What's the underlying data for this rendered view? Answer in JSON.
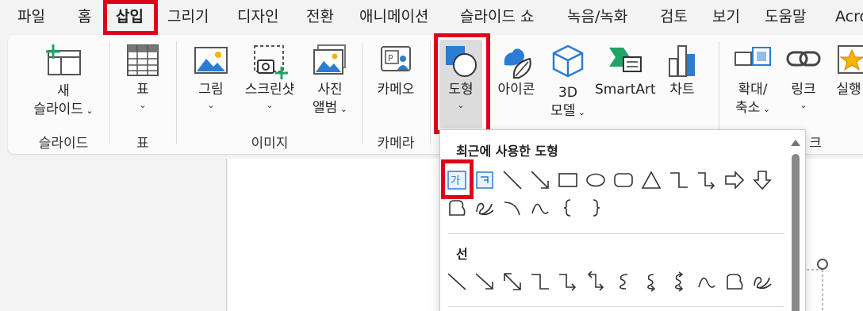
{
  "menu": {
    "tabs": [
      "파일",
      "홈",
      "삽입",
      "그리기",
      "디자인",
      "전환",
      "애니메이션",
      "슬라이드 쇼",
      "녹음/녹화",
      "검토",
      "보기",
      "도움말",
      "Acro"
    ],
    "active_index": 2
  },
  "ribbon": {
    "new_slide": {
      "line1": "새",
      "line2": "슬라이드"
    },
    "table": {
      "label": "표"
    },
    "pictures": {
      "label": "그림"
    },
    "screenshot": {
      "label": "스크린샷"
    },
    "photo_album": {
      "line1": "사진",
      "line2": "앨범"
    },
    "cameo": {
      "label": "카메오"
    },
    "shapes": {
      "label": "도형"
    },
    "icons": {
      "label": "아이콘"
    },
    "models3d": {
      "line1": "3D",
      "line2": "모델"
    },
    "smartart": {
      "label": "SmartArt"
    },
    "chart": {
      "label": "차트"
    },
    "zoom": {
      "line1": "확대/",
      "line2": "축소"
    },
    "link": {
      "label": "링크"
    },
    "action": {
      "label": "실행"
    },
    "groups": {
      "slides": "슬라이드",
      "tables": "표",
      "images": "이미지",
      "camera": "카메라",
      "links_tail": "크"
    }
  },
  "gallery": {
    "recent_title": "최근에 사용한 도형",
    "lines_title": "선",
    "textbox_glyph": "가"
  },
  "colors": {
    "highlight_red": "#e0001b",
    "accent_blue": "#2b7cd3",
    "accent_green": "#21a366"
  }
}
